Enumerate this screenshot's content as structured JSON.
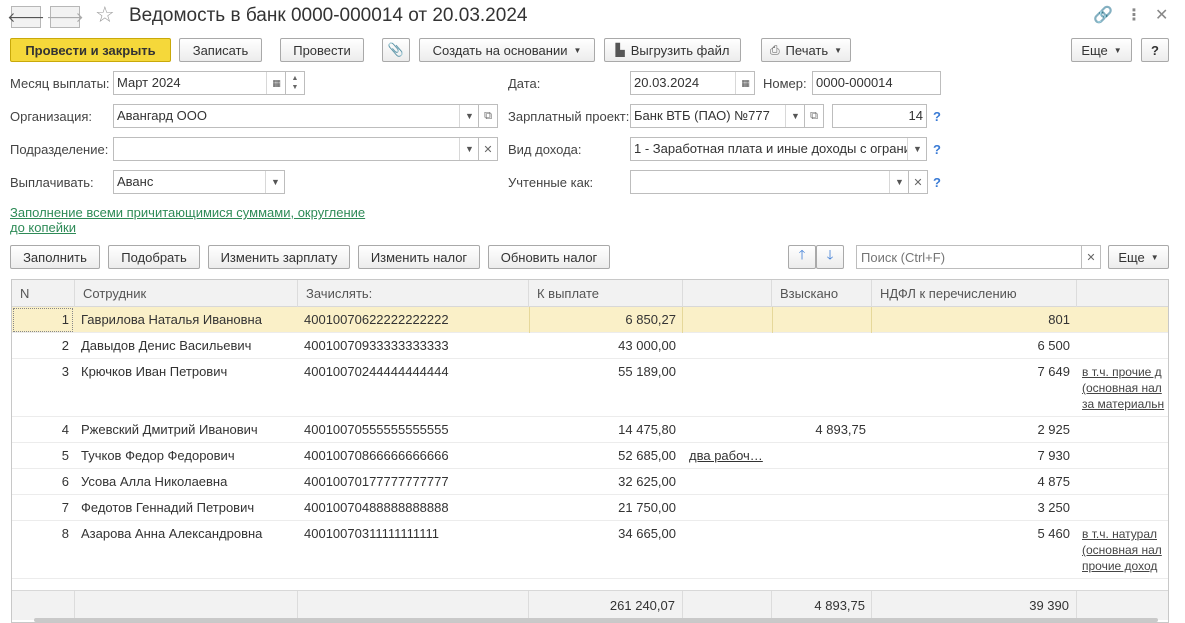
{
  "window": {
    "title": "Ведомость в банк 0000-000014 от 20.03.2024"
  },
  "toolbar": {
    "post_close": "Провести и закрыть",
    "save": "Записать",
    "post": "Провести",
    "create_based": "Создать на основании",
    "upload_file": "Выгрузить файл",
    "print": "Печать",
    "more": "Еще",
    "help": "?"
  },
  "form": {
    "month_label": "Месяц выплаты:",
    "month_value": "Март 2024",
    "date_label": "Дата:",
    "date_value": "20.03.2024",
    "number_label": "Номер:",
    "number_value": "0000-000014",
    "org_label": "Организация:",
    "org_value": "Авангард ООО",
    "salary_project_label": "Зарплатный проект:",
    "salary_project_value": "Банк ВТБ (ПАО) №777",
    "salary_project_code": "14",
    "division_label": "Подразделение:",
    "division_value": "",
    "income_type_label": "Вид дохода:",
    "income_type_value": "1 - Заработная плата и иные доходы с ограни",
    "pay_label": "Выплачивать:",
    "pay_value": "Аванс",
    "counted_label": "Учтенные как:",
    "counted_value": "",
    "fill_link_line1": "Заполнение всеми причитающимися суммами, округление",
    "fill_link_line2": "до копейки"
  },
  "table_toolbar": {
    "fill": "Заполнить",
    "pick": "Подобрать",
    "change_salary": "Изменить зарплату",
    "change_tax": "Изменить налог",
    "update_tax": "Обновить налог",
    "search_placeholder": "Поиск (Ctrl+F)",
    "more": "Еще"
  },
  "table": {
    "columns": [
      "N",
      "Сотрудник",
      "Зачислять:",
      "К выплате",
      "",
      "Взыскано",
      "НДФЛ к перечислению"
    ],
    "rows": [
      {
        "n": "1",
        "employee": "Гаврилова Наталья Ивановна",
        "account": "40010070622222222222",
        "pay": "6 850,27",
        "extra": "",
        "collected": "",
        "ndfl": "801",
        "note": []
      },
      {
        "n": "2",
        "employee": "Давыдов Денис Васильевич",
        "account": "40010070933333333333",
        "pay": "43 000,00",
        "extra": "",
        "collected": "",
        "ndfl": "6 500",
        "note": []
      },
      {
        "n": "3",
        "employee": "Крючков Иван Петрович",
        "account": "40010070244444444444",
        "pay": "55 189,00",
        "extra": "",
        "collected": "",
        "ndfl": "7 649",
        "note": [
          "в т.ч. прочие д",
          "(основная нал",
          "за материальн"
        ]
      },
      {
        "n": "4",
        "employee": "Ржевский Дмитрий Иванович",
        "account": "40010070555555555555",
        "pay": "14 475,80",
        "extra": "",
        "collected": "4 893,75",
        "ndfl": "2 925",
        "note": []
      },
      {
        "n": "5",
        "employee": "Тучков Федор Федорович",
        "account": "40010070866666666666",
        "pay": "52 685,00",
        "extra": "два рабоч…",
        "collected": "",
        "ndfl": "7 930",
        "note": []
      },
      {
        "n": "6",
        "employee": "Усова Алла Николаевна",
        "account": "40010070177777777777",
        "pay": "32 625,00",
        "extra": "",
        "collected": "",
        "ndfl": "4 875",
        "note": []
      },
      {
        "n": "7",
        "employee": "Федотов Геннадий Петрович",
        "account": "40010070488888888888",
        "pay": "21 750,00",
        "extra": "",
        "collected": "",
        "ndfl": "3 250",
        "note": []
      },
      {
        "n": "8",
        "employee": "Азарова Анна Александровна",
        "account": "40010070311111111111",
        "pay": "34 665,00",
        "extra": "",
        "collected": "",
        "ndfl": "5 460",
        "note": [
          "в т.ч. натурал",
          "(основная нал",
          "прочие доход"
        ]
      }
    ],
    "totals": {
      "pay": "261 240,07",
      "collected": "4 893,75",
      "ndfl": "39 390"
    }
  },
  "colors": {
    "primary_button": "#f5d83a",
    "link": "#2e8b57",
    "help": "#3a7bd5",
    "selected_row": "#faf0c8"
  }
}
